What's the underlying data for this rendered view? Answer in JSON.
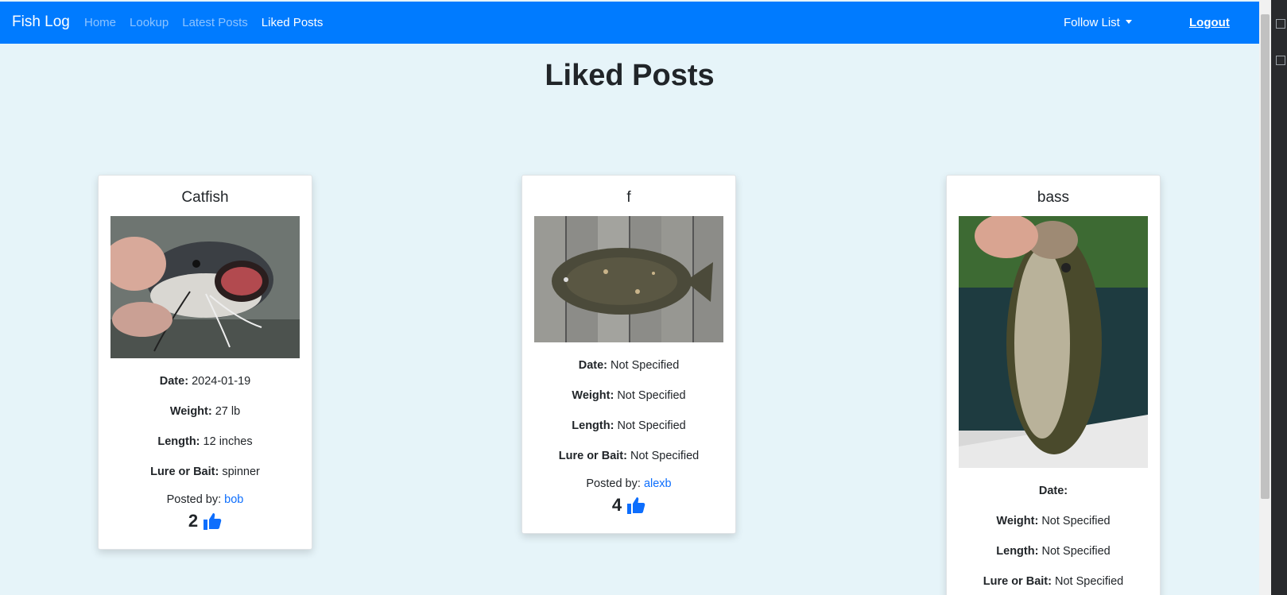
{
  "nav": {
    "brand": "Fish Log",
    "links": [
      "Home",
      "Lookup",
      "Latest Posts",
      "Liked Posts"
    ],
    "follow_list": "Follow List",
    "logout": "Logout"
  },
  "page": {
    "title": "Liked Posts"
  },
  "posts": [
    {
      "title": "Catfish",
      "date_label": "Date:",
      "date": "2024-01-19",
      "weight_label": "Weight:",
      "weight": "27 lb",
      "length_label": "Length:",
      "length": "12 inches",
      "lure_label": "Lure or Bait:",
      "lure": "spinner",
      "posted_label": "Posted by:",
      "user": "bob",
      "likes": "2"
    },
    {
      "title": "f",
      "date_label": "Date:",
      "date": "Not Specified",
      "weight_label": "Weight:",
      "weight": "Not Specified",
      "length_label": "Length:",
      "length": "Not Specified",
      "lure_label": "Lure or Bait:",
      "lure": "Not Specified",
      "posted_label": "Posted by:",
      "user": "alexb",
      "likes": "4"
    },
    {
      "title": "bass",
      "date_label": "Date:",
      "date": "",
      "weight_label": "Weight:",
      "weight": "Not Specified",
      "length_label": "Length:",
      "length": "Not Specified",
      "lure_label": "Lure or Bait:",
      "lure": "Not Specified"
    }
  ],
  "colors": {
    "navbar": "#007bff",
    "page_bg": "#e6f4f9",
    "link": "#0d6efd"
  }
}
